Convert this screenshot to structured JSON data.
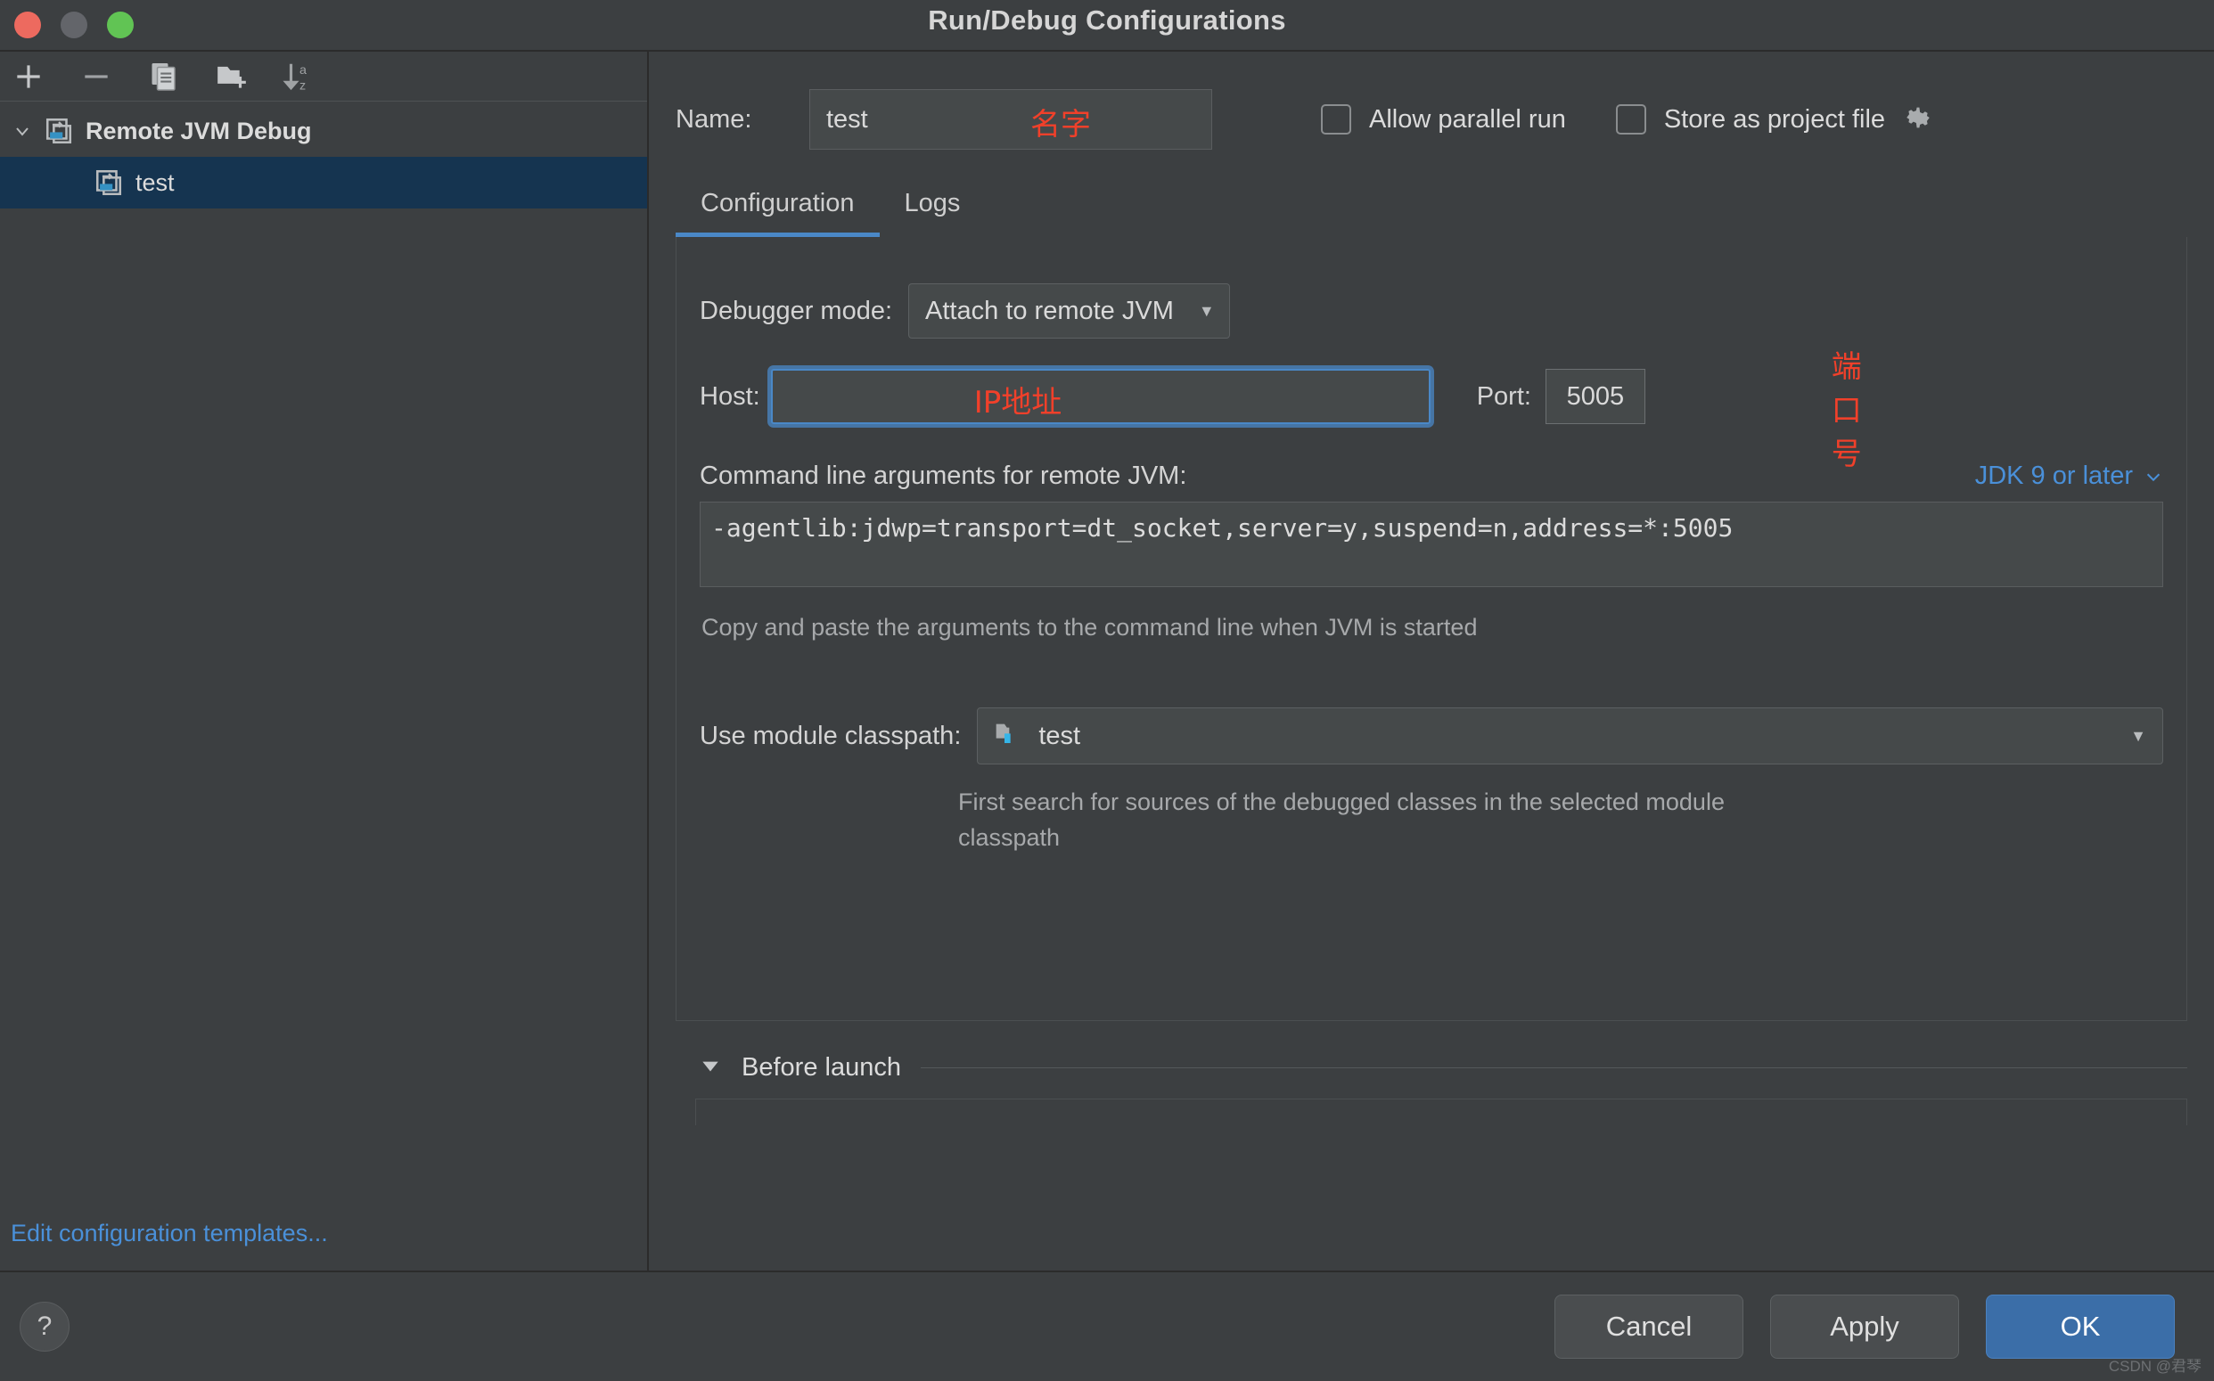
{
  "window": {
    "title": "Run/Debug Configurations"
  },
  "sidebar": {
    "toolbar": [
      {
        "name": "add-button",
        "label": "+"
      },
      {
        "name": "remove-button",
        "label": "−"
      },
      {
        "name": "copy-button",
        "label": "copy-icon"
      },
      {
        "name": "new-folder-button",
        "label": "new-folder-icon"
      },
      {
        "name": "sort-button",
        "label": "sort-alphabetically-icon"
      }
    ],
    "tree": {
      "group_label": "Remote JVM Debug",
      "child_label": "test"
    },
    "edit_templates_link": "Edit configuration templates..."
  },
  "form": {
    "name_label": "Name:",
    "name_value": "test",
    "name_annotation": "名字",
    "allow_parallel_run_label": "Allow parallel run",
    "allow_parallel_run_checked": false,
    "store_as_project_file_label": "Store as project file",
    "store_as_project_file_checked": false
  },
  "tabs": [
    {
      "label": "Configuration",
      "active": true
    },
    {
      "label": "Logs",
      "active": false
    }
  ],
  "configuration": {
    "debugger_mode_label": "Debugger mode:",
    "debugger_mode_value": "Attach to remote JVM",
    "host_label": "Host:",
    "host_value": "",
    "host_annotation": "IP地址",
    "port_label": "Port:",
    "port_value": "5005",
    "port_annotation": "端口号",
    "args_label": "Command line arguments for remote JVM:",
    "jdk_link": "JDK 9 or later",
    "args_value": "-agentlib:jdwp=transport=dt_socket,server=y,suspend=n,address=*:5005",
    "args_hint": "Copy and paste the arguments to the command line when JVM is started",
    "module_classpath_label": "Use module classpath:",
    "module_classpath_value": "test",
    "module_classpath_hint": "First search for sources of the debugged classes in the selected module classpath"
  },
  "before_launch": {
    "label": "Before launch"
  },
  "footer": {
    "help_label": "?",
    "cancel_label": "Cancel",
    "apply_label": "Apply",
    "ok_label": "OK",
    "watermark": "CSDN @君琴"
  },
  "colors": {
    "accent_blue": "#4a88c7",
    "link_blue": "#4a90d9",
    "annotation_red": "#f1402a",
    "selection_navy": "#153450",
    "panel_bg": "#3c3f41",
    "field_bg": "#45494a"
  }
}
